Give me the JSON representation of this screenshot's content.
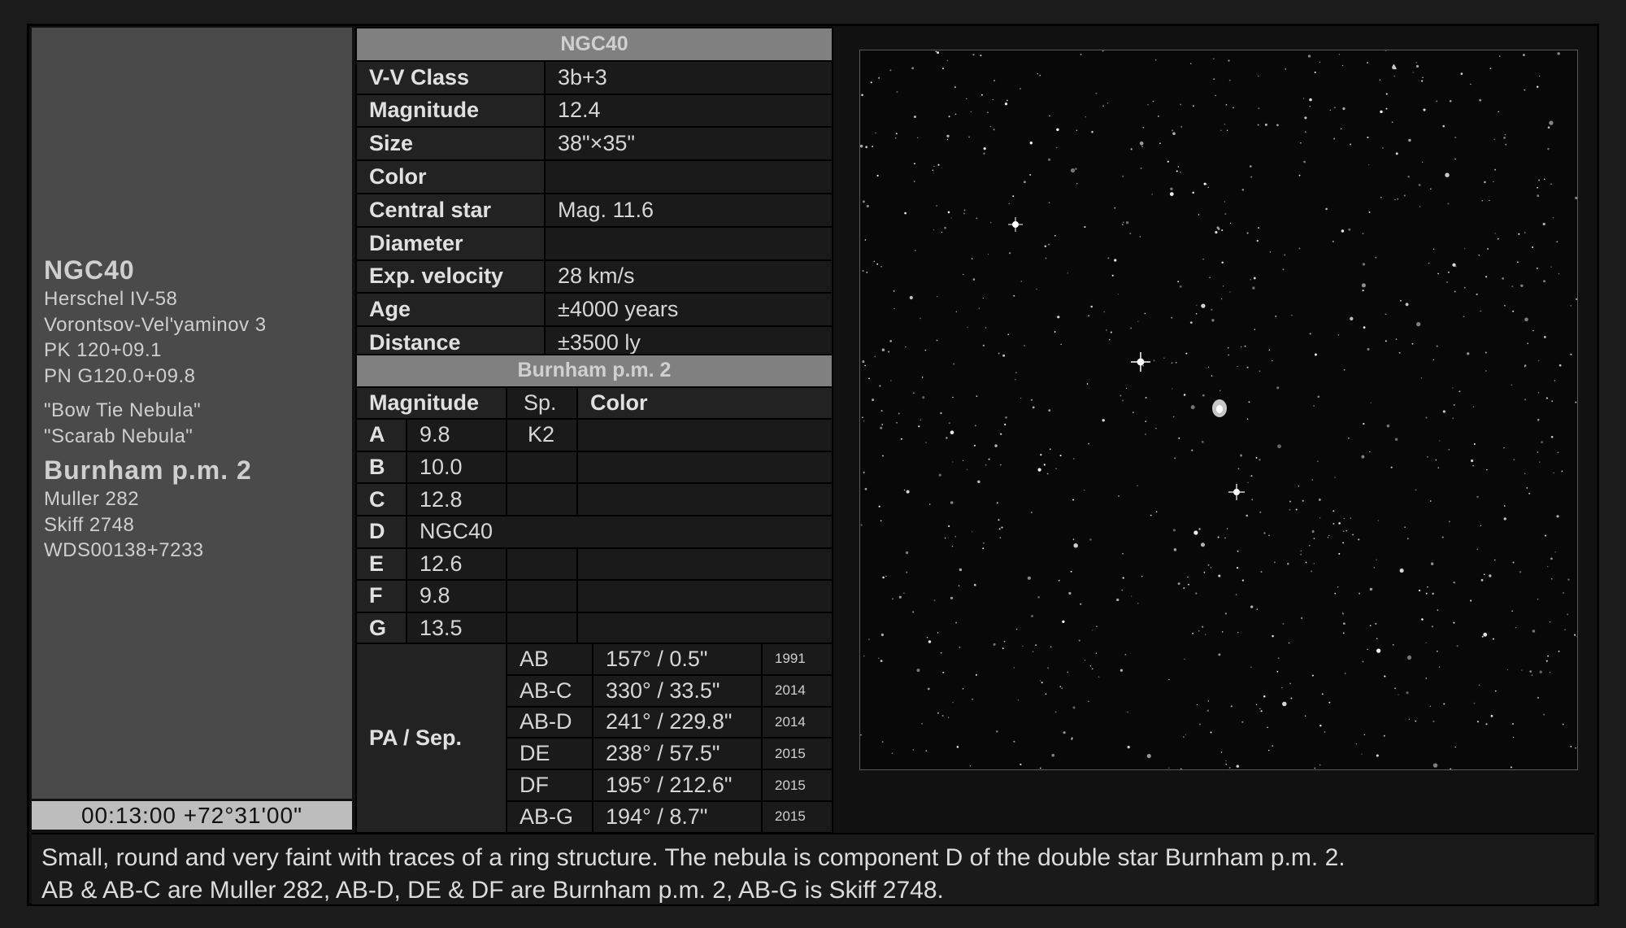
{
  "identifiers": {
    "main_name": "NGC40",
    "catalog_lines": [
      "Herschel IV-58",
      "Vorontsov-Vel'yaminov 3",
      "PK 120+09.1",
      "PN G120.0+09.8"
    ],
    "nicknames": [
      "\"Bow Tie Nebula\"",
      "\"Scarab Nebula\""
    ],
    "double_name": "Burnham p.m. 2",
    "double_lines": [
      "Muller 282",
      "Skiff 2748",
      "WDS00138+7233"
    ]
  },
  "coordinates": "00:13:00 +72°31'00\"",
  "nebula_table": {
    "title": "NGC40",
    "rows": [
      {
        "label": "V-V Class",
        "value": "3b+3"
      },
      {
        "label": "Magnitude",
        "value": "12.4"
      },
      {
        "label": "Size",
        "value": "38\"×35\""
      },
      {
        "label": "Color",
        "value": ""
      },
      {
        "label": "Central star",
        "value": "Mag. 11.6"
      },
      {
        "label": "Diameter",
        "value": ""
      },
      {
        "label": "Exp. velocity",
        "value": "28 km/s"
      },
      {
        "label": "Age",
        "value": "±4000 years"
      },
      {
        "label": "Distance",
        "value": "±3500 ly"
      }
    ]
  },
  "double_table": {
    "title": "Burnham p.m. 2",
    "headers": {
      "mag": "Magnitude",
      "sp": "Sp.",
      "color": "Color"
    },
    "rows": [
      {
        "comp": "A",
        "mag": "9.8",
        "sp": "K2",
        "color": ""
      },
      {
        "comp": "B",
        "mag": "10.0",
        "sp": "",
        "color": ""
      },
      {
        "comp": "C",
        "mag": "12.8",
        "sp": "",
        "color": ""
      },
      {
        "comp": "D",
        "mag": "NGC40",
        "sp": "",
        "color": ""
      },
      {
        "comp": "E",
        "mag": "12.6",
        "sp": "",
        "color": ""
      },
      {
        "comp": "F",
        "mag": "9.8",
        "sp": "",
        "color": ""
      },
      {
        "comp": "G",
        "mag": "13.5",
        "sp": "",
        "color": ""
      }
    ]
  },
  "pa_table": {
    "label": "PA / Sep.",
    "rows": [
      {
        "pair": "AB",
        "measure": "157° / 0.5\"",
        "year": "1991"
      },
      {
        "pair": "AB-C",
        "measure": "330° / 33.5\"",
        "year": "2014"
      },
      {
        "pair": "AB-D",
        "measure": "241° / 229.8\"",
        "year": "2014"
      },
      {
        "pair": "DE",
        "measure": "238° / 57.5\"",
        "year": "2015"
      },
      {
        "pair": "DF",
        "measure": "195° / 212.6\"",
        "year": "2015"
      },
      {
        "pair": "AB-G",
        "measure": "194° / 8.7\"",
        "year": "2015"
      }
    ]
  },
  "description": [
    "Small, round and very faint with traces of a ring structure. The nebula is component D of the double star Burnham p.m. 2.",
    "AB & AB-C are Muller 282, AB-D, DE & DF are Burnham p.m. 2, AB-G is Skiff 2748."
  ],
  "colors": {
    "panel": "#4a4a4a",
    "header": "#808080",
    "sky": "#080808"
  }
}
